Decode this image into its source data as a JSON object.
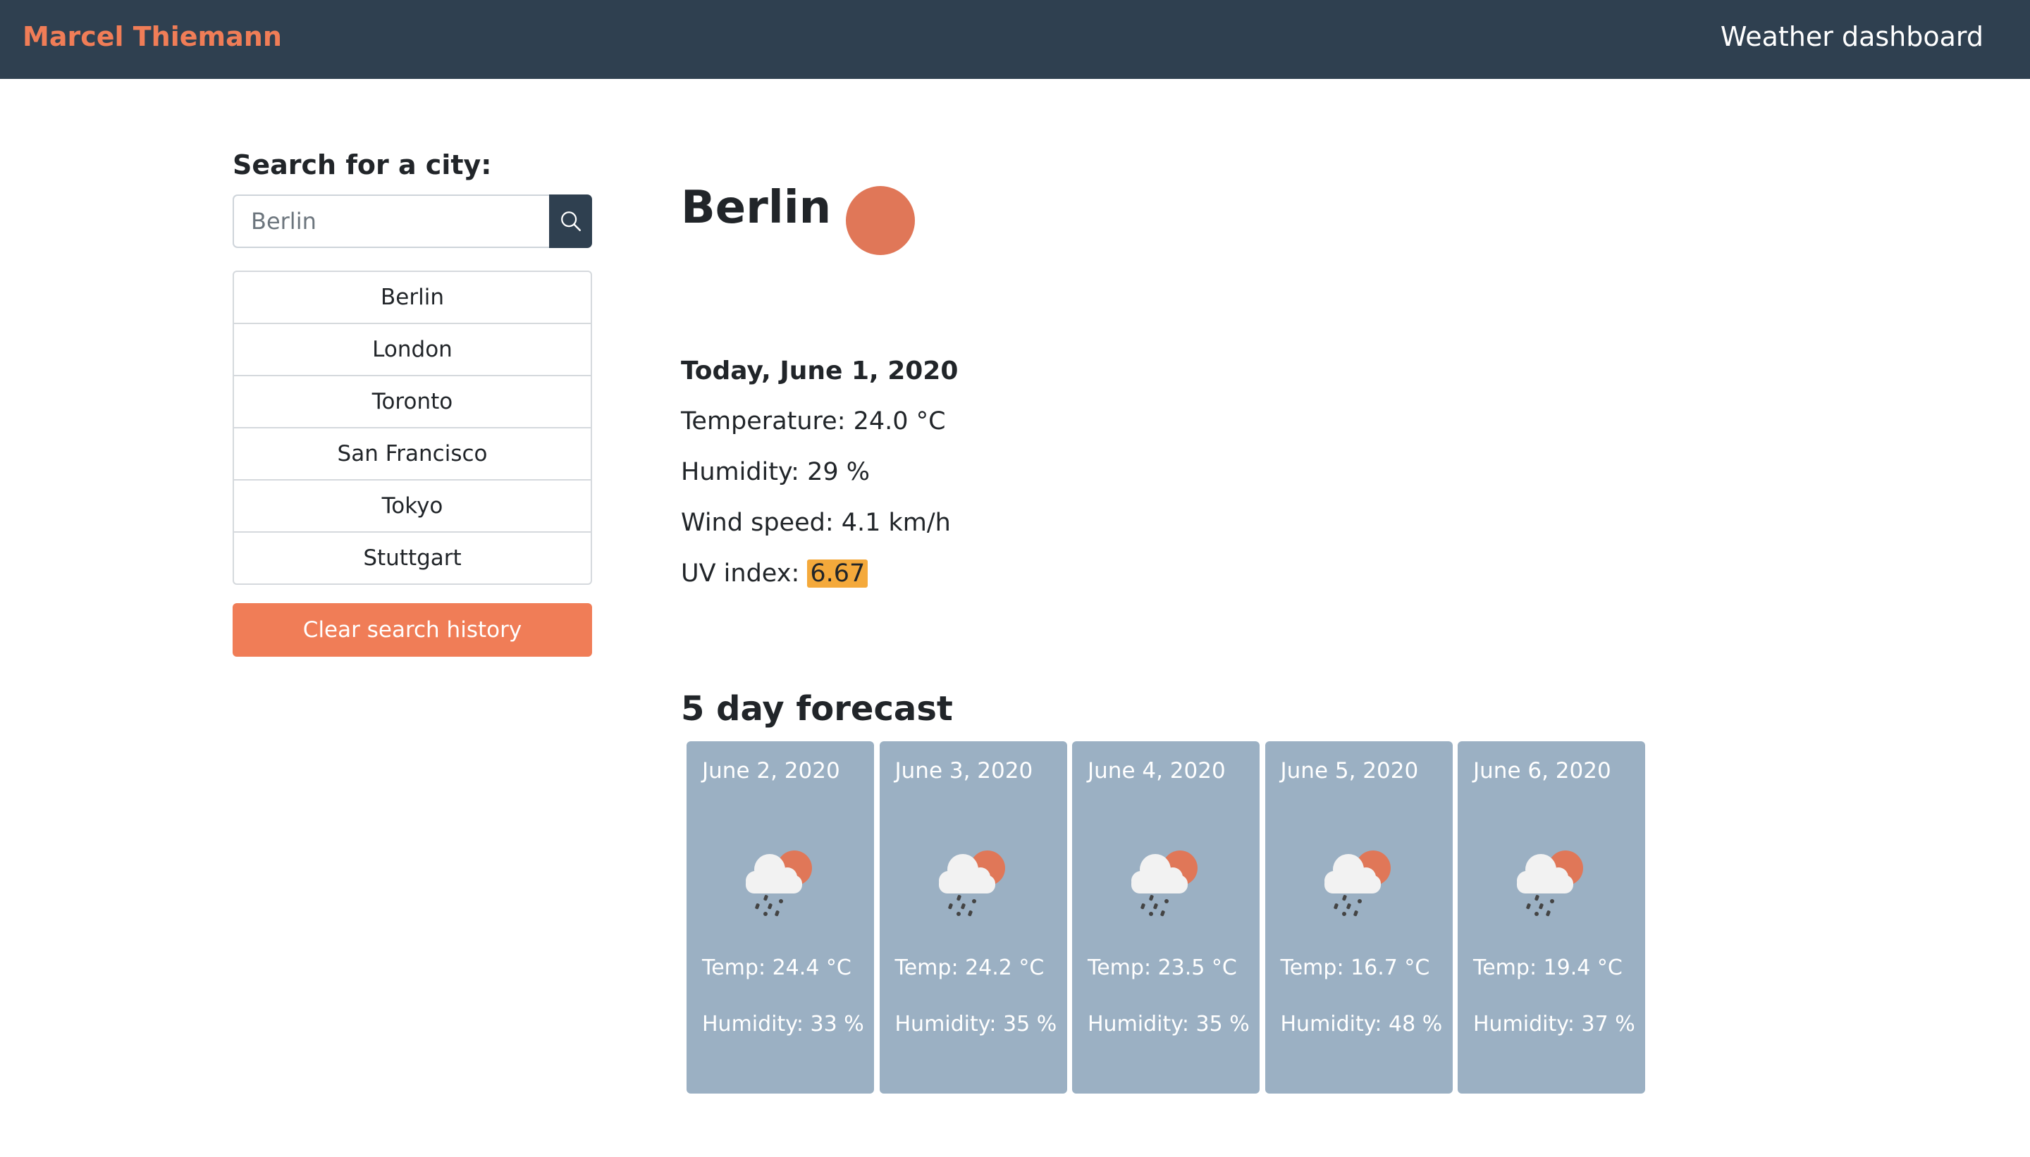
{
  "header": {
    "brand": "Marcel Thiemann",
    "title": "Weather dashboard"
  },
  "sidebar": {
    "label": "Search for a city:",
    "search_placeholder": "Berlin",
    "search_icon": "search-icon",
    "history": [
      "Berlin",
      "London",
      "Toronto",
      "San Francisco",
      "Tokyo",
      "Stuttgart"
    ],
    "clear_label": "Clear search history"
  },
  "current": {
    "city": "Berlin",
    "today": "Today, June 1, 2020",
    "temperature_label": "Temperature: 24.0 °C",
    "humidity_label": "Humidity: 29 %",
    "wind_label": "Wind speed: 4.1 km/h",
    "uv_label": "UV index: ",
    "uv_value": "6.67",
    "uv_color": "#f4a93b",
    "icon": "sun-icon"
  },
  "forecast": {
    "title": "5 day forecast",
    "days": [
      {
        "date": "June 2, 2020",
        "temp": "Temp: 24.4 °C",
        "humidity": "Humidity: 33 %"
      },
      {
        "date": "June 3, 2020",
        "temp": "Temp: 24.2 °C",
        "humidity": "Humidity: 35 %"
      },
      {
        "date": "June 4, 2020",
        "temp": "Temp: 23.5 °C",
        "humidity": "Humidity: 35 %"
      },
      {
        "date": "June 5, 2020",
        "temp": "Temp: 16.7 °C",
        "humidity": "Humidity: 48 %"
      },
      {
        "date": "June 6, 2020",
        "temp": "Temp: 19.4 °C",
        "humidity": "Humidity: 37 %"
      }
    ],
    "icon": "rain-sun-cloud-icon"
  },
  "colors": {
    "header": "#2f4050",
    "accent": "#f07d57",
    "card": "#9bb0c3"
  }
}
